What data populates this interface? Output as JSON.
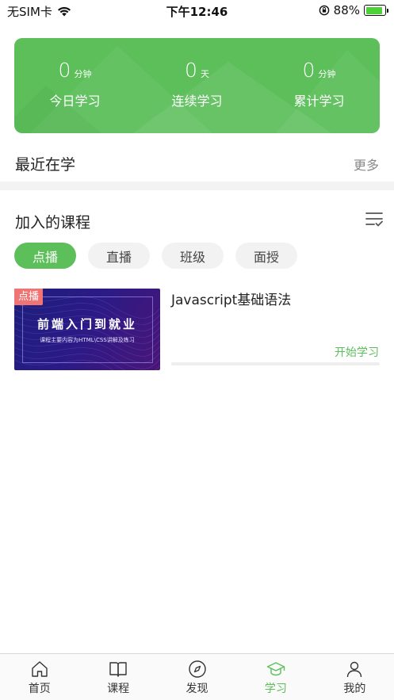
{
  "status_bar": {
    "carrier": "无SIM卡",
    "time": "下午12:46",
    "battery_percent": "88%",
    "battery_level": 0.88
  },
  "stats": [
    {
      "value": "0",
      "unit": "分钟",
      "label": "今日学习"
    },
    {
      "value": "0",
      "unit": "天",
      "label": "连续学习"
    },
    {
      "value": "0",
      "unit": "分钟",
      "label": "累计学习"
    }
  ],
  "recent": {
    "title": "最近在学",
    "more": "更多"
  },
  "courses": {
    "title": "加入的课程",
    "filters": [
      "点播",
      "直播",
      "班级",
      "面授"
    ],
    "active_filter": 0,
    "items": [
      {
        "badge": "点播",
        "thumb_title": "前端入门到就业",
        "thumb_subtitle": "课程主要内容为HTML\\CSS讲解及练习",
        "name": "Javascript基础语法",
        "action": "开始学习",
        "progress": 0
      }
    ]
  },
  "tab_bar": {
    "items": [
      {
        "label": "首页",
        "icon": "home-icon"
      },
      {
        "label": "课程",
        "icon": "book-icon"
      },
      {
        "label": "发现",
        "icon": "compass-icon"
      },
      {
        "label": "学习",
        "icon": "graduation-cap-icon"
      },
      {
        "label": "我的",
        "icon": "user-icon"
      }
    ],
    "active": 3
  },
  "colors": {
    "accent": "#5cbf5a",
    "badge": "#f07474"
  }
}
